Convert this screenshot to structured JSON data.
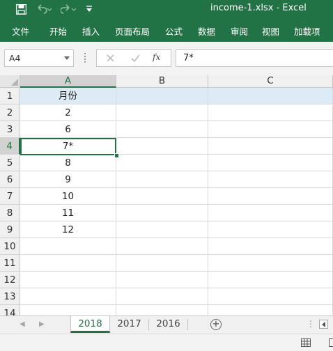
{
  "window": {
    "title": "income-1.xlsx  -  Excel"
  },
  "quick_access": {
    "icons": [
      "save-icon",
      "undo-icon",
      "redo-icon",
      "customize-qat-icon"
    ]
  },
  "ribbon": {
    "tabs": [
      {
        "label": "文件"
      },
      {
        "label": "开始"
      },
      {
        "label": "插入"
      },
      {
        "label": "页面布局"
      },
      {
        "label": "公式"
      },
      {
        "label": "数据"
      },
      {
        "label": "审阅"
      },
      {
        "label": "视图"
      },
      {
        "label": "加载项"
      }
    ]
  },
  "formula_bar": {
    "name_box": "A4",
    "fx_label": "fx",
    "content": "7*"
  },
  "sheet": {
    "selected_cell": "A4",
    "columns": [
      {
        "label": "A"
      },
      {
        "label": "B"
      },
      {
        "label": "C"
      }
    ],
    "rows": [
      {
        "num": "1",
        "a": "月份"
      },
      {
        "num": "2",
        "a": "2"
      },
      {
        "num": "3",
        "a": "6"
      },
      {
        "num": "4",
        "a": "7*"
      },
      {
        "num": "5",
        "a": "8"
      },
      {
        "num": "6",
        "a": "9"
      },
      {
        "num": "7",
        "a": "10"
      },
      {
        "num": "8",
        "a": "11"
      },
      {
        "num": "9",
        "a": "12"
      },
      {
        "num": "10",
        "a": ""
      },
      {
        "num": "11",
        "a": ""
      },
      {
        "num": "12",
        "a": ""
      },
      {
        "num": "13",
        "a": ""
      },
      {
        "num": "14",
        "a": ""
      }
    ]
  },
  "sheet_tabs": {
    "tabs": [
      {
        "label": "2018"
      },
      {
        "label": "2017"
      },
      {
        "label": "2016"
      }
    ],
    "active": "2018"
  },
  "colors": {
    "accent": "#217346",
    "header_fill": "#ddebf7"
  }
}
